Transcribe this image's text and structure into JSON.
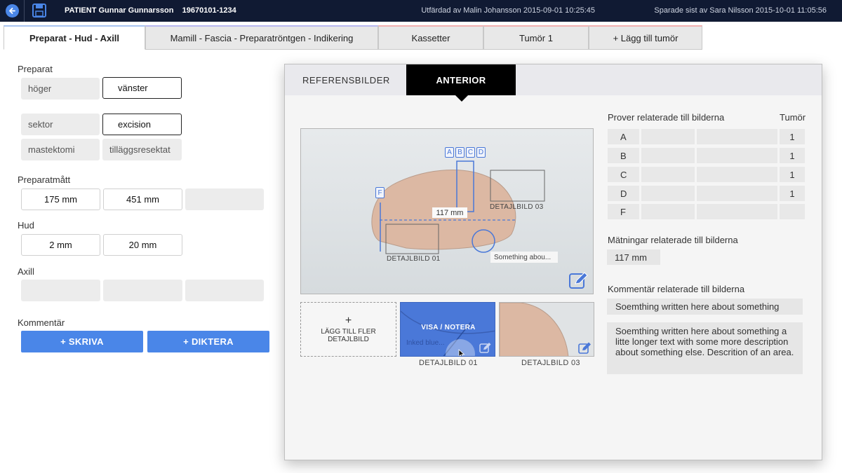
{
  "topbar": {
    "patient": "PATIENT Gunnar Gunnarsson",
    "pnr": "19670101-1234",
    "issued": "Utfärdad av Malin Johansson 2015-09-01 10:25:45",
    "saved": "Sparade sist av Sara Nilsson 2015-10-01 11:05:56"
  },
  "tabs": [
    {
      "label": "Preparat - Hud - Axill"
    },
    {
      "label": "Mamill - Fascia - Preparatröntgen - Indikering"
    },
    {
      "label": "Kassetter"
    },
    {
      "label": "Tumör 1"
    },
    {
      "label": "+ Lägg till tumör"
    }
  ],
  "form": {
    "preparat_label": "Preparat",
    "preparat_options": {
      "hoger": "höger",
      "vanster": "vänster",
      "sektor": "sektor",
      "excision": "excision",
      "mastektomi": "mastektomi",
      "tillagg": "tilläggsresektat"
    },
    "preparatmatt_label": "Preparatmått",
    "preparatmatt_values": [
      "175 mm",
      "451 mm"
    ],
    "hud_label": "Hud",
    "hud_values": [
      "2 mm",
      "20 mm"
    ],
    "axill_label": "Axill",
    "kommentar_label": "Kommentär",
    "skriva_button": "+ SKRIVA",
    "diktera_button": "+ DIKTERA"
  },
  "panel": {
    "tab_ref": "REFERENSBILDER",
    "tab_anterior": "ANTERIOR",
    "image": {
      "markers": [
        "A",
        "B",
        "C",
        "D",
        "F"
      ],
      "measurement": "117 mm",
      "detail1": "DETAJLBILD 01",
      "detail3": "DETAJLBILD 03",
      "note": "Something abou..."
    },
    "add_detail": {
      "plus": "+",
      "label": "LÄGG TILL FLER DETAJLBILD"
    },
    "thumb1": {
      "overlay": "VISA / NOTERA",
      "inked": "Inked blue...",
      "caption": "DETAJLBILD 01"
    },
    "thumb2": {
      "caption": "DETAJLBILD 03"
    },
    "samples_header": "Prover relaterade till bilderna",
    "tumor_header": "Tumör",
    "samples": [
      {
        "id": "A",
        "tumor": "1"
      },
      {
        "id": "B",
        "tumor": "1"
      },
      {
        "id": "C",
        "tumor": "1"
      },
      {
        "id": "D",
        "tumor": "1"
      },
      {
        "id": "F",
        "tumor": ""
      }
    ],
    "measurements_header": "Mätningar relaterade till bilderna",
    "measurement_value": "117 mm",
    "comments_header": "Kommentär relaterade till bilderna",
    "comment_short": "Soemthing written here about something",
    "comment_long": "Soemthing written here about something a litte longer text with some more description about something else. Descrition of an area."
  },
  "colors": {
    "topbar": "#101a33",
    "accent_blue": "#4a86e8",
    "tissue": "#dcb8a3",
    "marker_blue": "#4a78d8"
  }
}
